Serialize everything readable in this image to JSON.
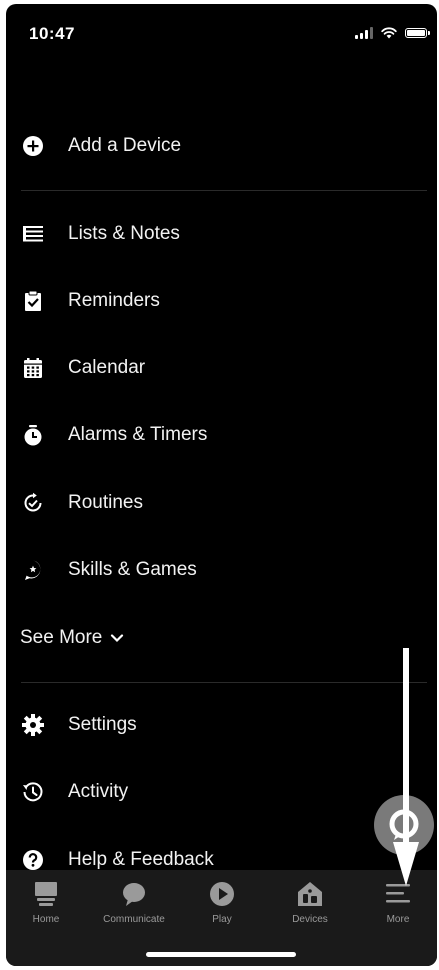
{
  "status_bar": {
    "time": "10:47"
  },
  "menu": {
    "items": [
      {
        "label": "Add a Device",
        "icon": "plus-circle-icon"
      },
      {
        "label": "Lists & Notes",
        "icon": "list-icon"
      },
      {
        "label": "Reminders",
        "icon": "clipboard-check-icon"
      },
      {
        "label": "Calendar",
        "icon": "calendar-icon"
      },
      {
        "label": "Alarms & Timers",
        "icon": "alarm-clock-icon"
      },
      {
        "label": "Routines",
        "icon": "routines-icon"
      },
      {
        "label": "Skills & Games",
        "icon": "skills-icon"
      },
      {
        "label": "Settings",
        "icon": "gear-icon"
      },
      {
        "label": "Activity",
        "icon": "history-icon"
      },
      {
        "label": "Help & Feedback",
        "icon": "question-circle-icon"
      }
    ],
    "see_more_label": "See More"
  },
  "bottom_nav": {
    "items": [
      {
        "label": "Home",
        "icon": "home-icon"
      },
      {
        "label": "Communicate",
        "icon": "chat-bubble-icon"
      },
      {
        "label": "Play",
        "icon": "play-circle-icon"
      },
      {
        "label": "Devices",
        "icon": "devices-house-icon"
      },
      {
        "label": "More",
        "icon": "hamburger-menu-icon"
      }
    ],
    "active": "More"
  },
  "colors": {
    "background": "#000000",
    "text": "#f2f2f2",
    "nav_background": "#1a1a1a",
    "nav_label": "#9a9a9a",
    "fab": "#7a7a7a",
    "annotation_arrow": "#ffffff"
  }
}
